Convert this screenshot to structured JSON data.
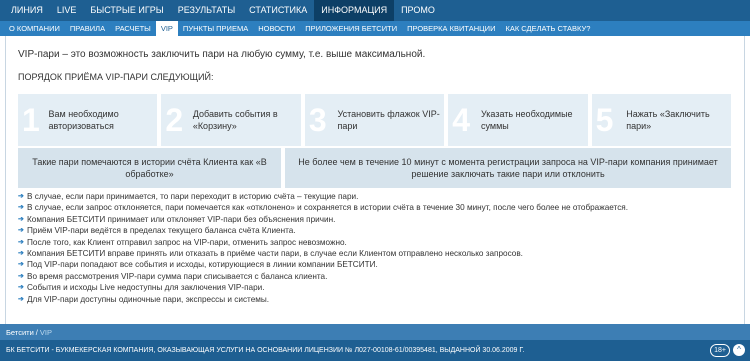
{
  "topnav": {
    "items": [
      "ЛИНИЯ",
      "LIVE",
      "БЫСТРЫЕ ИГРЫ",
      "РЕЗУЛЬТАТЫ",
      "СТАТИСТИКА",
      "ИНФОРМАЦИЯ",
      "ПРОМО"
    ],
    "active": "ИНФОРМАЦИЯ"
  },
  "subnav": {
    "items": [
      "О КОМПАНИИ",
      "ПРАВИЛА",
      "РАСЧЕТЫ",
      "VIP",
      "ПУНКТЫ ПРИЕМА",
      "НОВОСТИ",
      "ПРИЛОЖЕНИЯ БЕТСИТИ",
      "ПРОВЕРКА КВИТАНЦИИ",
      "КАК СДЕЛАТЬ СТАВКУ?"
    ],
    "active": "VIP"
  },
  "content": {
    "intro": "VIP-пари – это возможность заключить пари на любую сумму, т.е. выше максимальной.",
    "heading": "ПОРЯДОК ПРИЁМА VIP-ПАРИ СЛЕДУЮЩИЙ:",
    "steps": [
      {
        "num": "1",
        "text": "Вам необходимо авторизоваться"
      },
      {
        "num": "2",
        "text": "Добавить события в «Корзину»"
      },
      {
        "num": "3",
        "text": "Установить флажок VIP-пари"
      },
      {
        "num": "4",
        "text": "Указать необходимые суммы"
      },
      {
        "num": "5",
        "text": "Нажать «Заключить пари»"
      }
    ],
    "notes": [
      "Такие пари помечаются в истории счёта Клиента как «В обработке»",
      "Не более чем в течение 10 минут с момента регистрации запроса на VIP-пари компания принимает решение заключать такие пари или отклонить"
    ],
    "bullets": [
      "В случае, если пари принимается, то пари переходит в историю счёта – текущие пари.",
      "В случае, если запрос отклоняется, пари помечается как «отклонено» и сохраняется в истории счёта в течение 30 минут, после чего более не отображается.",
      "Компания БЕТСИТИ принимает или отклоняет VIP-пари без объяснения причин.",
      "Приём VIP-пари ведётся в пределах текущего баланса счёта Клиента.",
      "После того, как Клиент отправил запрос на VIP-пари, отменить запрос невозможно.",
      "Компания БЕТСИТИ вправе принять или отказать в приёме части пари, в случае если Клиентом отправлено несколько запросов.",
      "Под VIP-пари попадают все события и исходы, котирующиеся в линии компании БЕТСИТИ.",
      "Во время рассмотрения VIP-пари сумма пари списывается с баланса клиента.",
      "События и исходы Live недоступны для заключения VIP-пари.",
      "Для VIP-пари доступны одиночные пари, экспрессы и системы."
    ]
  },
  "breadcrumb": {
    "root": "Бетсити",
    "separator": "/",
    "current": "VIP"
  },
  "footer": {
    "text": "БК БЕТСИТИ - БУКМЕКЕРСКАЯ КОМПАНИЯ, ОКАЗЫВАЮЩАЯ УСЛУГИ НА ОСНОВАНИИ ЛИЦЕНЗИИ № Л027-00108-61/00395481, ВЫДАННОЙ 30.06.2009 Г.",
    "age_badge": "18+",
    "scroll_up": "^"
  },
  "colors": {
    "topnav_bg": "#1e5f92",
    "subnav_bg": "#2d7fbf",
    "step_bg": "#e4eef5",
    "note_bg": "#d6e3ec",
    "bullet_arrow": "#2d7fbf"
  }
}
